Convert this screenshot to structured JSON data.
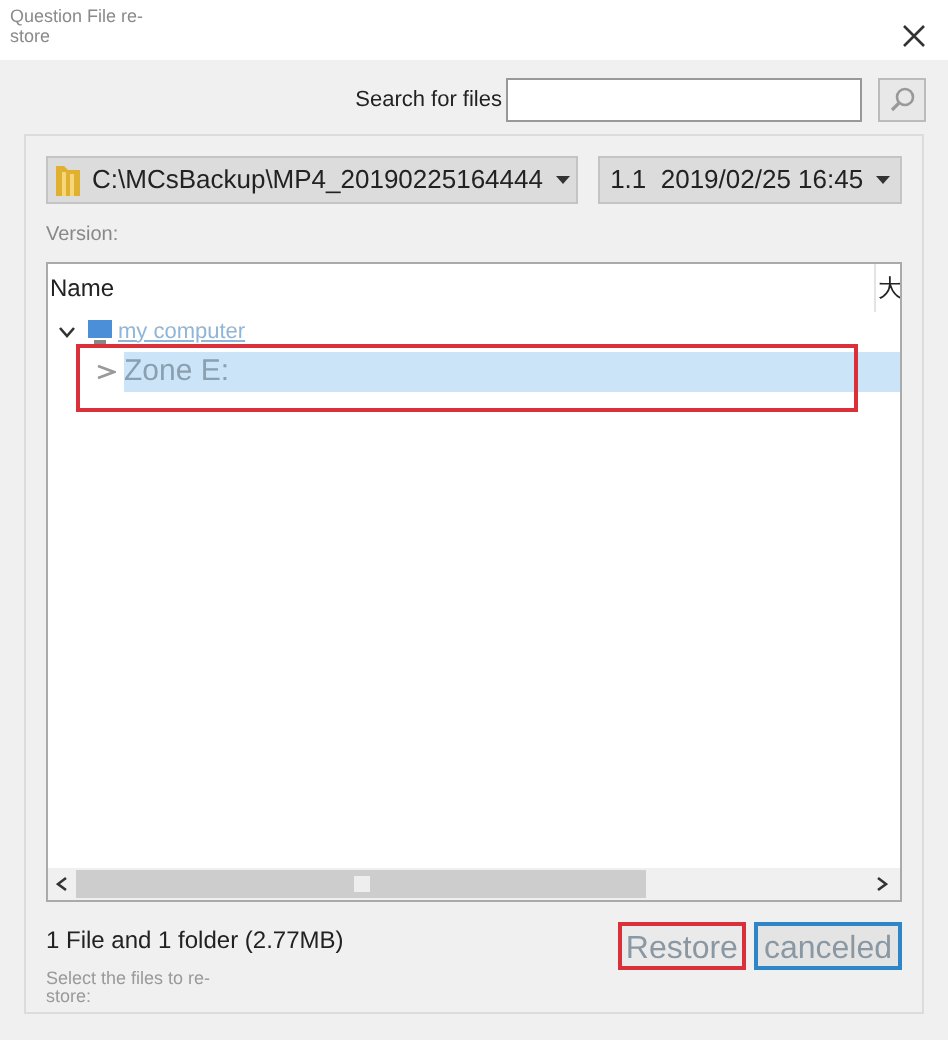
{
  "window": {
    "title": "Question File re-store"
  },
  "search": {
    "label": "Search for files"
  },
  "backup_path": {
    "value": "C:\\MCsBackup\\MP4_20190225164444"
  },
  "version_select": {
    "value": "1.1  2019/02/25 16:45"
  },
  "version_label": "Version:",
  "table": {
    "columns": [
      "Name",
      "大"
    ],
    "tree": [
      {
        "label": "my computer",
        "expanded": true,
        "selected": false,
        "children": [
          {
            "label": "Zone E:",
            "expanded": false,
            "selected": true
          }
        ]
      }
    ]
  },
  "summary": "1 File and 1 folder (2.77MB)",
  "hint": "Select the files to re-store:",
  "buttons": [
    {
      "label": "Restore",
      "kind": "primary"
    },
    {
      "label": "canceled",
      "kind": "secondary"
    }
  ]
}
